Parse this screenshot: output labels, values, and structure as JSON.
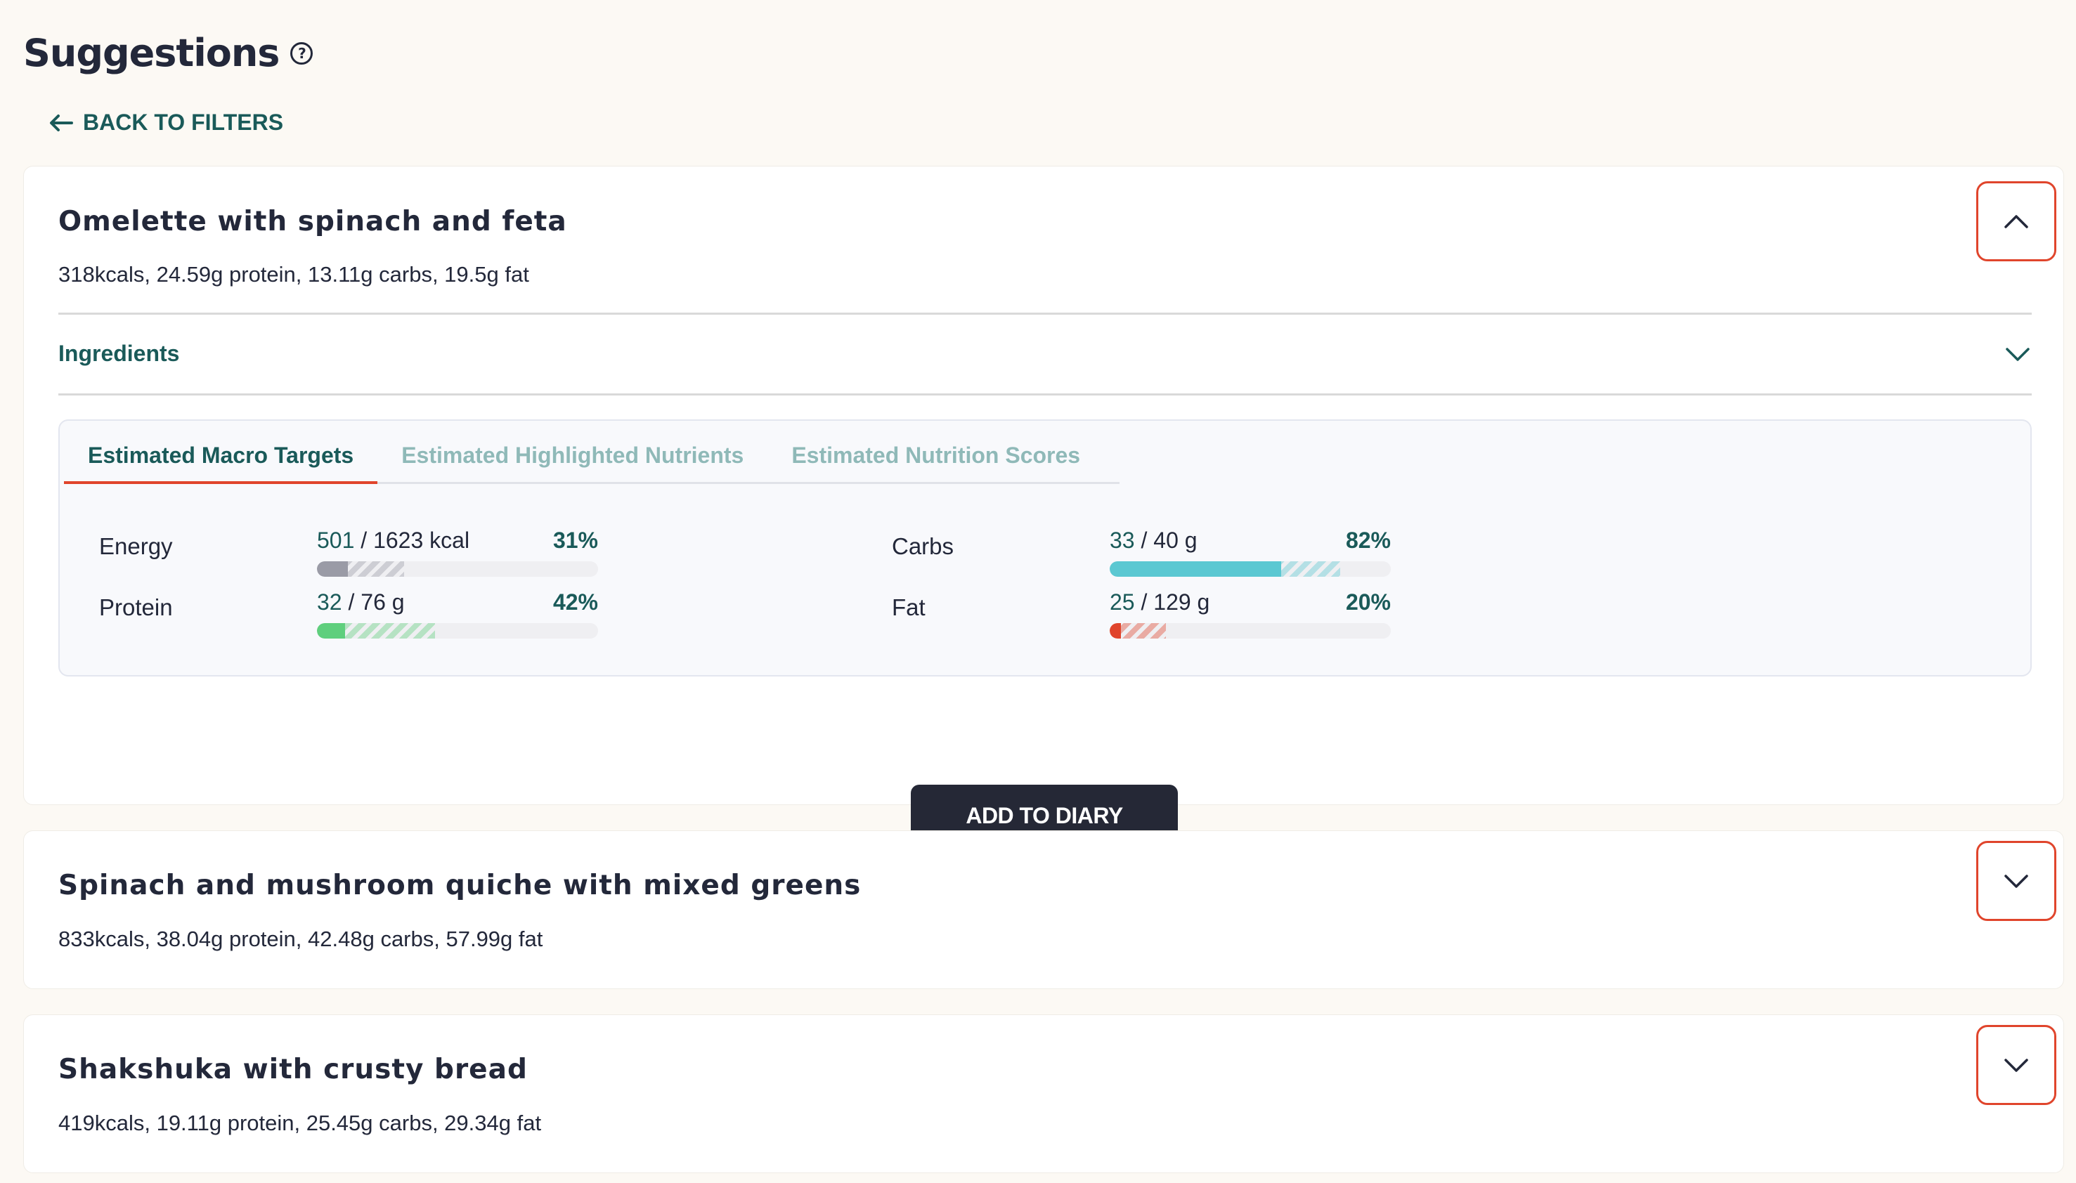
{
  "header": {
    "title": "Suggestions",
    "help_glyph": "?",
    "back_label": "BACK TO FILTERS"
  },
  "colors": {
    "accent_teal": "#1a5a59",
    "accent_red": "#e0452c",
    "energy": "#9a9ba6",
    "protein": "#5fcf7d",
    "carbs": "#5bc8d2",
    "fat": "#e0452c"
  },
  "cards": [
    {
      "title": "Omelette with spinach and feta",
      "summary": "318kcals, 24.59g protein, 13.11g carbs, 19.5g fat",
      "expanded": true,
      "toggle_icon": "chevron-up-icon",
      "ingredients_label": "Ingredients",
      "tabs": [
        {
          "label": "Estimated Macro Targets",
          "active": true
        },
        {
          "label": "Estimated Highlighted Nutrients",
          "active": false
        },
        {
          "label": "Estimated Nutrition Scores",
          "active": false
        }
      ],
      "metrics": [
        {
          "name": "Energy",
          "current": "501",
          "target": " / 1623 kcal",
          "percent": "31%",
          "fill_fraction": 0.11,
          "projected_fraction": 0.31
        },
        {
          "name": "Carbs",
          "current": "33",
          "target": " / 40 g",
          "percent": "82%",
          "fill_fraction": 0.61,
          "projected_fraction": 0.82
        },
        {
          "name": "Protein",
          "current": "32",
          "target": " / 76 g",
          "percent": "42%",
          "fill_fraction": 0.1,
          "projected_fraction": 0.42
        },
        {
          "name": "Fat",
          "current": "25",
          "target": " / 129 g",
          "percent": "20%",
          "fill_fraction": 0.04,
          "projected_fraction": 0.2
        }
      ],
      "add_label": "ADD TO DIARY"
    },
    {
      "title": "Spinach and mushroom quiche with mixed greens",
      "summary": "833kcals, 38.04g protein, 42.48g carbs, 57.99g fat",
      "expanded": false,
      "toggle_icon": "chevron-down-icon"
    },
    {
      "title": "Shakshuka with crusty bread",
      "summary": "419kcals, 19.11g protein, 25.45g carbs, 29.34g fat",
      "expanded": false,
      "toggle_icon": "chevron-down-icon"
    }
  ]
}
